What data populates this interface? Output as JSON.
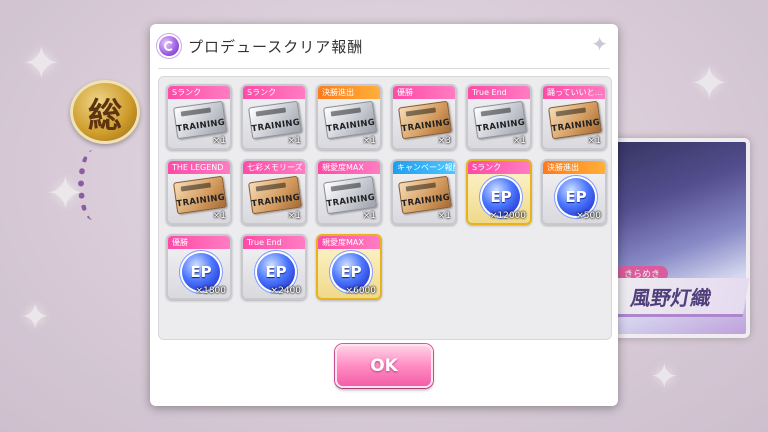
{
  "background": {
    "rank_badge_char": "総",
    "idol_name": "風野灯織",
    "idol_tag": "きらめき"
  },
  "dialog": {
    "title": "プロデュースクリア報酬",
    "ok_label": "OK"
  },
  "rewards": [
    {
      "tag": "Sランク",
      "tag_color": "pink",
      "kind": "ticket",
      "ticket": "silver",
      "ticket_text": "TRAINING",
      "qty": "×1"
    },
    {
      "tag": "Sランク",
      "tag_color": "pink",
      "kind": "ticket",
      "ticket": "silver",
      "ticket_text": "TRAINING",
      "qty": "×1"
    },
    {
      "tag": "決勝進出",
      "tag_color": "orange",
      "kind": "ticket",
      "ticket": "silver",
      "ticket_text": "TRAINING",
      "qty": "×1"
    },
    {
      "tag": "優勝",
      "tag_color": "pink",
      "kind": "ticket",
      "ticket": "bronze",
      "ticket_text": "TRAINING",
      "qty": "×3"
    },
    {
      "tag": "True End",
      "tag_color": "pink",
      "kind": "ticket",
      "ticket": "silver",
      "ticket_text": "TRAINING",
      "qty": "×1"
    },
    {
      "tag": "踊っていいと…",
      "tag_color": "pink",
      "kind": "ticket",
      "ticket": "bronze",
      "ticket_text": "TRAINING",
      "qty": "×1"
    },
    {
      "tag": "THE LEGEND",
      "tag_color": "pink",
      "kind": "ticket",
      "ticket": "bronze",
      "ticket_text": "TRAINING",
      "qty": "×1"
    },
    {
      "tag": "七彩メモリーズ",
      "tag_color": "pink",
      "kind": "ticket",
      "ticket": "bronze",
      "ticket_text": "TRAINING",
      "qty": "×1"
    },
    {
      "tag": "親愛度MAX",
      "tag_color": "pink",
      "kind": "ticket",
      "ticket": "silver",
      "ticket_text": "TRAINING",
      "qty": "×1"
    },
    {
      "tag": "キャンペーン報酬",
      "tag_color": "blue",
      "kind": "ticket",
      "ticket": "bronze",
      "ticket_text": "TRAINING",
      "qty": "×1"
    },
    {
      "tag": "Sランク",
      "tag_color": "pink",
      "kind": "ep",
      "ep_text": "EP",
      "qty": "×12000",
      "gold": true
    },
    {
      "tag": "決勝進出",
      "tag_color": "orange",
      "kind": "ep",
      "ep_text": "EP",
      "qty": "×500"
    },
    {
      "tag": "優勝",
      "tag_color": "pink",
      "kind": "ep",
      "ep_text": "EP",
      "qty": "×1800"
    },
    {
      "tag": "True End",
      "tag_color": "pink",
      "kind": "ep",
      "ep_text": "EP",
      "qty": "×2400"
    },
    {
      "tag": "親愛度MAX",
      "tag_color": "pink",
      "kind": "ep",
      "ep_text": "EP",
      "qty": "×6000",
      "gold": true
    }
  ]
}
